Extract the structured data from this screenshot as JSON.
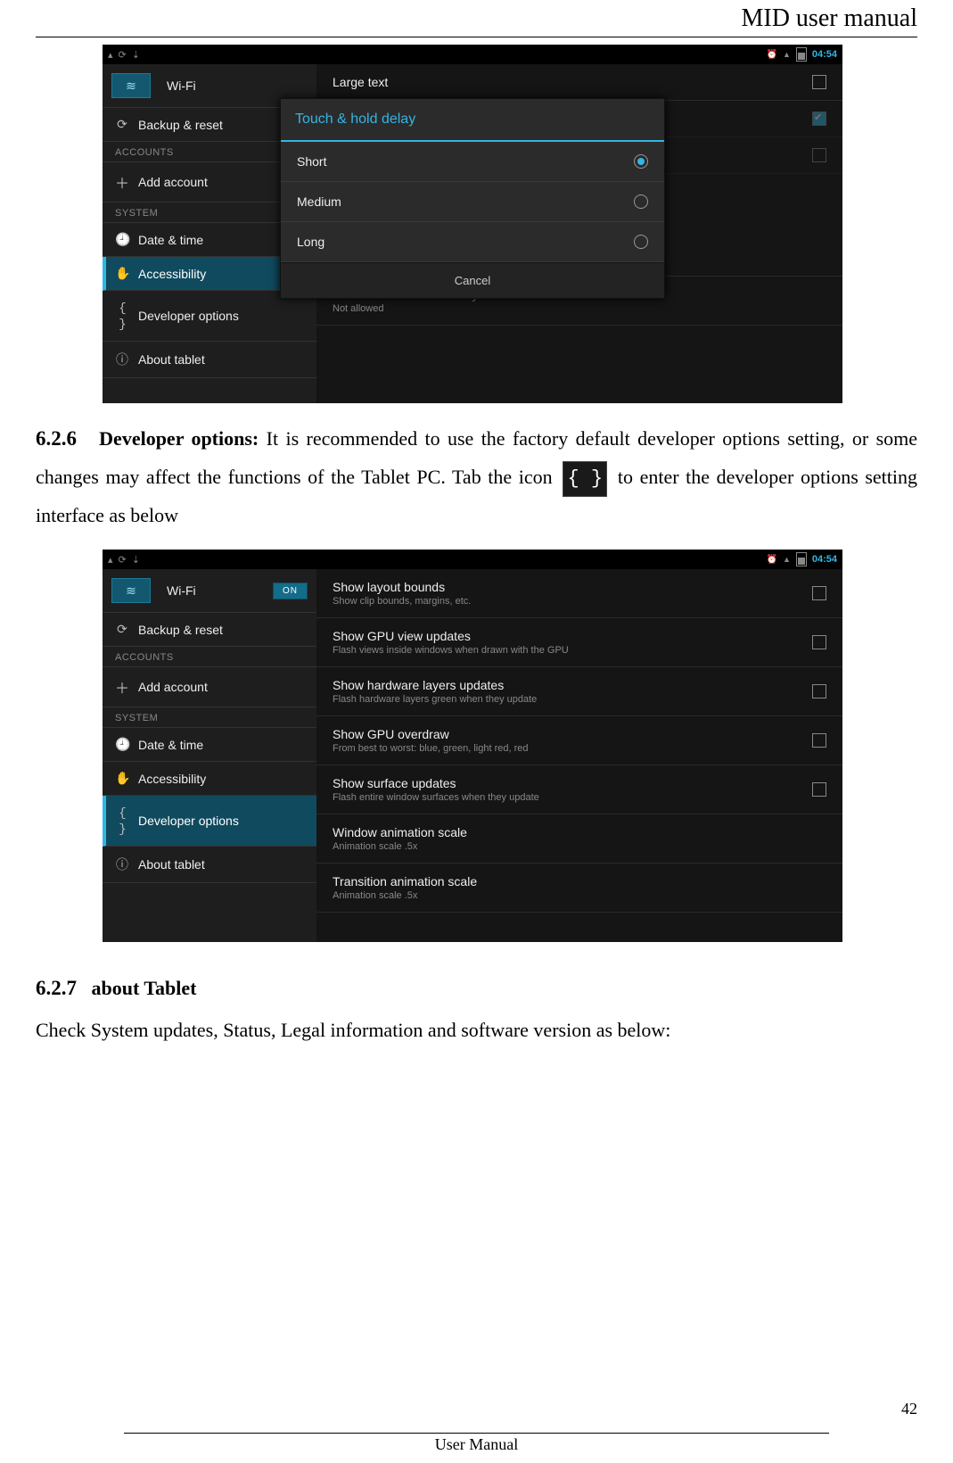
{
  "header": {
    "title": "MID user manual"
  },
  "footer": {
    "label": "User Manual",
    "page_num": "42"
  },
  "sec626": {
    "num": "6.2.6",
    "head": "Developer options:",
    "text_a": " It is recommended to use the factory default developer options setting, or some changes may affect the functions of the Tablet PC. Tab the icon ",
    "icon_glyph": "{ }",
    "text_b": " to enter the developer options setting interface as below"
  },
  "sec627": {
    "num": "6.2.7",
    "head": "about Tablet",
    "text": "Check System updates, Status, Legal information and software version as below:"
  },
  "ss_common": {
    "time": "04:54",
    "wifi_label": "Wi-Fi",
    "add_account": "Add account",
    "accounts_hdr": "ACCOUNTS",
    "system_hdr": "SYSTEM",
    "backup": "Backup & reset",
    "datetime": "Date & time",
    "accessibility": "Accessibility",
    "devoptions": "Developer options",
    "abouttablet": "About tablet"
  },
  "ss1": {
    "large_text": "Large text",
    "touch_hold": "Touch & hold delay",
    "touch_hold_sub": "Short",
    "enhance": "Enhance web accessibility",
    "enhance_sub": "Not allowed",
    "dlg_title": "Touch & hold delay",
    "opt_short": "Short",
    "opt_medium": "Medium",
    "opt_long": "Long",
    "cancel": "Cancel"
  },
  "ss2": {
    "on": "ON",
    "rows": [
      {
        "t": "Show layout bounds",
        "s": "Show clip bounds, margins, etc.",
        "cb": true
      },
      {
        "t": "Show GPU view updates",
        "s": "Flash views inside windows when drawn with the GPU",
        "cb": true
      },
      {
        "t": "Show hardware layers updates",
        "s": "Flash hardware layers green when they update",
        "cb": true
      },
      {
        "t": "Show GPU overdraw",
        "s": "From best to worst: blue, green, light red, red",
        "cb": true
      },
      {
        "t": "Show surface updates",
        "s": "Flash entire window surfaces when they update",
        "cb": true
      },
      {
        "t": "Window animation scale",
        "s": "Animation scale .5x",
        "cb": false
      },
      {
        "t": "Transition animation scale",
        "s": "Animation scale .5x",
        "cb": false
      }
    ]
  }
}
